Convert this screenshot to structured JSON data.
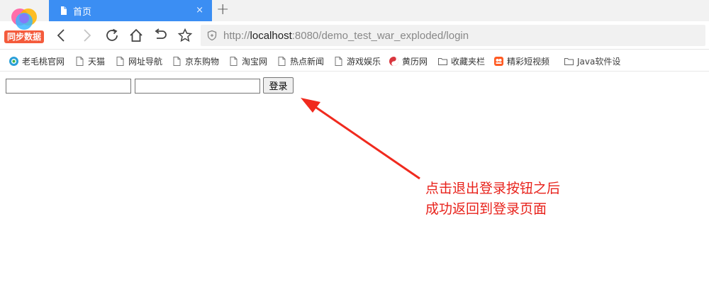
{
  "browser": {
    "logo_badge": "同步数据",
    "tab": {
      "title": "首页",
      "close_glyph": "×"
    },
    "new_tab_glyph": "+",
    "address": {
      "scheme": "http://",
      "host": "localhost",
      "rest": ":8080/demo_test_war_exploded/login"
    },
    "accent_color": "#3b8ef3"
  },
  "bookmarks": [
    {
      "label": "老毛桃官网",
      "icon": "globe-icon"
    },
    {
      "label": "天猫",
      "icon": "page-icon"
    },
    {
      "label": "网址导航",
      "icon": "page-icon"
    },
    {
      "label": "京东购物",
      "icon": "page-icon"
    },
    {
      "label": "淘宝网",
      "icon": "page-icon"
    },
    {
      "label": "热点新闻",
      "icon": "page-icon"
    },
    {
      "label": "游戏娱乐",
      "icon": "page-icon"
    },
    {
      "label": "黄历网",
      "icon": "yinyang-icon"
    },
    {
      "label": "收藏夹栏",
      "icon": "folder-icon"
    },
    {
      "label": "精彩短视频",
      "icon": "video-icon"
    },
    {
      "label": "Java软件设",
      "icon": "folder-icon"
    }
  ],
  "page": {
    "username_value": "",
    "password_value": "",
    "login_label": "登录",
    "annotation_line1": "点击退出登录按钮之后",
    "annotation_line2": "成功返回到登录页面",
    "annotation_color": "#e8221b"
  }
}
